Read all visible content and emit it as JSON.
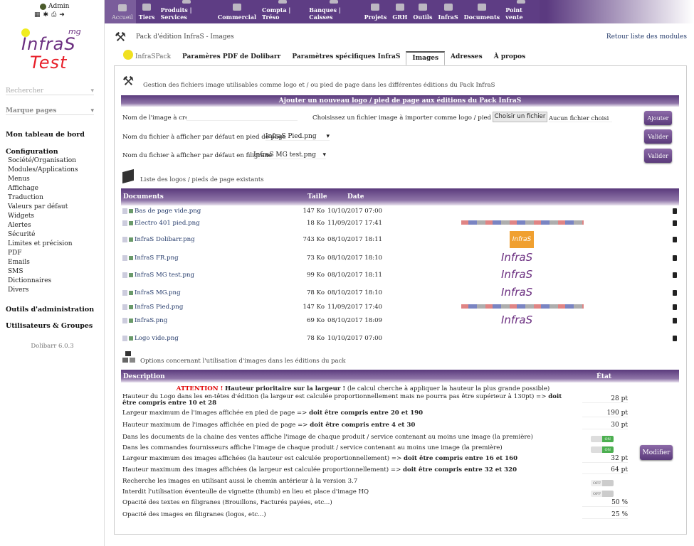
{
  "user": {
    "name": "Admin"
  },
  "logo": {
    "line1": "InfraS",
    "line2": "Test",
    "sup": "mg",
    "colors": {
      "primary": "#6b2f80",
      "secondary": "#e8202a"
    }
  },
  "sidebar": {
    "search_placeholder": "Rechercher",
    "bookmarks_placeholder": "Marque pages",
    "dashboard": "Mon tableau de bord",
    "config_title": "Configuration",
    "config_items": [
      "Société/Organisation",
      "Modules/Applications",
      "Menus",
      "Affichage",
      "Traduction",
      "Valeurs par défaut",
      "Widgets",
      "Alertes",
      "Sécurité",
      "Limites et précision",
      "PDF",
      "Emails",
      "SMS",
      "Dictionnaires",
      "Divers"
    ],
    "admin_tools": "Outils d'administration",
    "users_groups": "Utilisateurs & Groupes",
    "version": "Dolibarr 6.0.3"
  },
  "topmenu": [
    {
      "label": "Accueil",
      "active": true
    },
    {
      "label": "Tiers"
    },
    {
      "label": "Produits | Services"
    },
    {
      "label": "Commercial"
    },
    {
      "label": "Compta | Tréso"
    },
    {
      "label": "Banques | Caisses"
    },
    {
      "label": "Projets"
    },
    {
      "label": "GRH"
    },
    {
      "label": "Outils"
    },
    {
      "label": "InfraS"
    },
    {
      "label": "Documents"
    },
    {
      "label": "Point vente"
    }
  ],
  "page": {
    "title": "Pack d'édition InfraS - Images",
    "back_link": "Retour liste des modules"
  },
  "tabs": [
    {
      "label": "InfraSPack"
    },
    {
      "label": "Paramères PDF de Dolibarr"
    },
    {
      "label": "Paramètres spécifiques InfraS"
    },
    {
      "label": "Images",
      "selected": true
    },
    {
      "label": "Adresses"
    },
    {
      "label": "À propos"
    }
  ],
  "section1": {
    "title": "Gestion des fichiers image utilisables comme logo et / ou pied de page dans les différentes éditions du Pack InfraS",
    "header": "Ajouter un nouveau logo / pied de page aux éditions du Pack InfraS",
    "name_label": "Nom de l'image à créer",
    "name_value": "",
    "file_label": "Choisissez un fichier image à importer comme logo / pied de page",
    "file_button": "Choisir un fichier",
    "file_status": "Aucun fichier choisi",
    "add_button": "Ajouter",
    "footer_label": "Nom du fichier à afficher par défaut en pied de page",
    "footer_value": "InfraS Pied.png",
    "validate1": "Valider",
    "watermark_label": "Nom du fichier à afficher par défaut en filigrane",
    "watermark_value": "InfraS MG test.png",
    "validate2": "Valider"
  },
  "section2": {
    "title": "Liste des logos / pieds de page existants",
    "columns": [
      "Documents",
      "Taille",
      "Date"
    ],
    "files": [
      {
        "name": "Bas de page vide.png",
        "size": "147 Ko",
        "date": "10/10/2017 07:00",
        "preview": ""
      },
      {
        "name": "Electro 401 pied.png",
        "size": "18 Ko",
        "date": "11/09/2017 17:41",
        "preview": "brands"
      },
      {
        "name": "InfraS Dolibarr.png",
        "size": "743 Ko",
        "date": "08/10/2017 18:11",
        "preview": "InfraS"
      },
      {
        "name": "InfraS FR.png",
        "size": "73 Ko",
        "date": "08/10/2017 18:10",
        "preview": "InfraS"
      },
      {
        "name": "InfraS MG test.png",
        "size": "99 Ko",
        "date": "08/10/2017 18:11",
        "preview": "InfraS Test"
      },
      {
        "name": "InfraS MG.png",
        "size": "78 Ko",
        "date": "08/10/2017 18:10",
        "preview": "InfraS"
      },
      {
        "name": "InfraS Pied.png",
        "size": "147 Ko",
        "date": "11/09/2017 17:40",
        "preview": "brands"
      },
      {
        "name": "InfraS.png",
        "size": "69 Ko",
        "date": "08/10/2017 18:09",
        "preview": "InfraS"
      },
      {
        "name": "Logo vide.png",
        "size": "78 Ko",
        "date": "10/10/2017 07:00",
        "preview": ""
      }
    ]
  },
  "section3": {
    "title": "Options concernant l'utilisation d'images dans les éditions du pack",
    "col_desc": "Description",
    "col_state": "État",
    "attention": "ATTENTION !",
    "attention_bold": "Hauteur prioritaire sur la largeur !",
    "attention_rest": "(le calcul cherche à appliquer la hauteur la plus grande possible)",
    "options": [
      {
        "text": "Hauteur du Logo dans les en-têtes d'édition (la largeur est calculée proportionnellement mais ne pourra pas être supérieur à 130pt) =>",
        "bold": "doit être compris entre 10 et 28",
        "value": "28 pt"
      },
      {
        "text": "Largeur maximum de l'images affichée en pied de page =>",
        "bold": "doit être compris entre 20 et 190",
        "value": "190 pt"
      },
      {
        "text": "Hauteur maximum de l'images affichée en pied de page =>",
        "bold": "doit être compris entre 4 et 30",
        "value": "30 pt"
      },
      {
        "text": "Dans les documents de la chaine des ventes affiche l'image de chaque produit / service contenant au moins une image (la première)",
        "toggle": "ON"
      },
      {
        "text": "Dans les commandes fournisseurs affiche l'image de chaque produit / service contenant au moins une image (la première)",
        "toggle": "ON"
      },
      {
        "text": "Largeur maximum des images affichées (la hauteur est calculée proportionnellement) =>",
        "bold": "doit être compris entre 16 et 160",
        "value": "32 pt"
      },
      {
        "text": "Hauteur maximum des images affichées (la largeur est calculée proportionnellement) =>",
        "bold": "doit être compris entre 32 et 320",
        "value": "64 pt"
      },
      {
        "text": "Recherche les images en utilisant aussi le chemin antérieur à la version 3.7",
        "toggle": "OFF"
      },
      {
        "text": "Interdit l'utilisation éventeulle de vignette (thumb) en lieu et place d'image HQ",
        "toggle": "OFF"
      },
      {
        "text": "Opacité des textes en filigranes (Brouillons, Facturés payées, etc...)",
        "value": "50 %"
      },
      {
        "text": "Opacité des images en filigranes (logos, etc...)",
        "value": "25 %"
      }
    ],
    "modify_button": "Modifier"
  },
  "colors": {
    "accent": "#5e3d84",
    "link": "#263c6c",
    "attention": "#e00000",
    "toggle_on": "#4caf50"
  }
}
